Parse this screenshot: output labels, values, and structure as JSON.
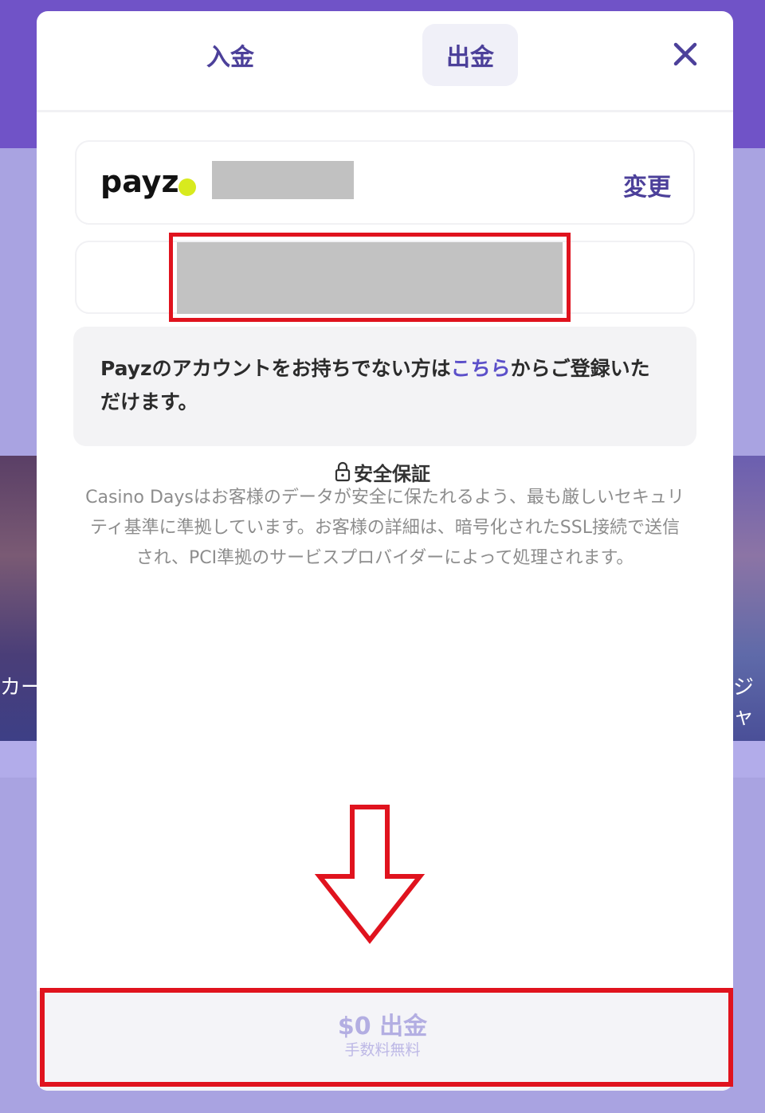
{
  "background": {
    "card_left_text": "カー",
    "card_right_text": "ジャ"
  },
  "tabs": [
    {
      "label": "入金"
    },
    {
      "label": "出金"
    }
  ],
  "method": {
    "logo_text": "payz",
    "change_label": "変更"
  },
  "info": {
    "text_before": "Payzのアカウントをお持ちでない方は",
    "link_text": "こちら",
    "text_after": "からご登録いただけます。"
  },
  "security": {
    "title": "安全保証",
    "line1": "Casino Daysはお客様のデータが安全に保たれるよう、最も厳しいセキュリ",
    "line2": "ティ基準に準拠しています。お客様の詳細は、暗号化されたSSL接続で送信",
    "line3": "され、PCI準拠のサービスプロバイダーによって処理されます。"
  },
  "footer": {
    "withdraw_label": "$0 出金",
    "fee_label": "手数料無料"
  },
  "colors": {
    "accent": "#4c409a",
    "link": "#5b4fc9",
    "highlight": "#e0131e",
    "header_bg": "#7053c7"
  },
  "icons": {
    "close": "close-icon",
    "lock": "lock-icon",
    "arrow": "down-arrow-icon"
  }
}
